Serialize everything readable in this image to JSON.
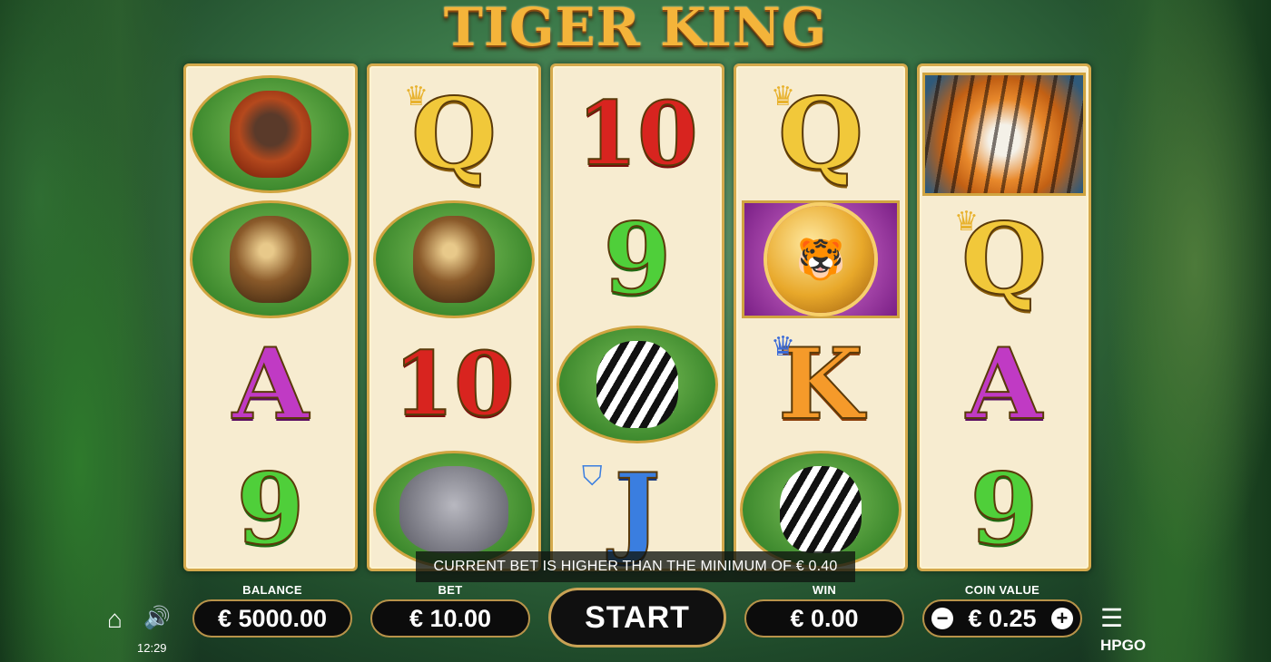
{
  "game": {
    "title": "TIGER KING"
  },
  "reels": [
    [
      "orangutan",
      "eagle",
      "A",
      "9"
    ],
    [
      "Q",
      "eagle",
      "10",
      "rhino"
    ],
    [
      "10",
      "9",
      "zebra",
      "J"
    ],
    [
      "Q",
      "tiger-coin",
      "K",
      "zebra"
    ],
    [
      "tiger",
      "Q",
      "A",
      "9"
    ]
  ],
  "notice": "CURRENT BET IS HIGHER THAN THE MINIMUM OF € 0.40",
  "balance": {
    "label": "BALANCE",
    "value": "€ 5000.00"
  },
  "bet": {
    "label": "BET",
    "value": "€ 10.00"
  },
  "start_label": "START",
  "win": {
    "label": "WIN",
    "value": "€ 0.00"
  },
  "coin_value": {
    "label": "COIN VALUE",
    "value": "€ 0.25",
    "minus": "−",
    "plus": "+"
  },
  "clock": "12:29",
  "brand": "HPGO",
  "icons": {
    "home": "home-icon",
    "sound": "speaker-icon",
    "menu": "hamburger-menu-icon"
  }
}
